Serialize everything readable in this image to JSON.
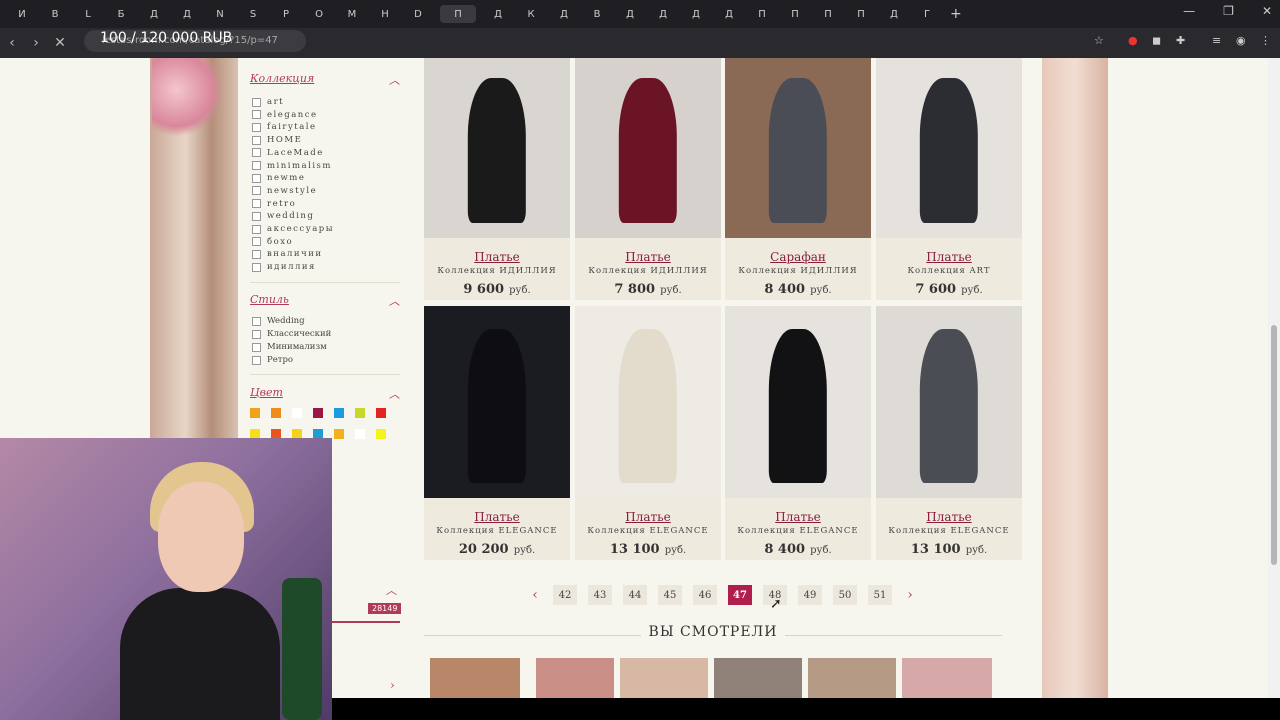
{
  "browser": {
    "tab_letters": [
      "И",
      "В",
      "L",
      "Б",
      "Д",
      "Д",
      "N",
      "S",
      "Р",
      "О",
      "М",
      "Н",
      "D",
      "П",
      "Д",
      "К",
      "Д",
      "В",
      "Д",
      "Д",
      "Д",
      "Д",
      "П",
      "П",
      "П",
      "П",
      "Д",
      "Г"
    ],
    "active_tab_label": "П",
    "url": "lestas-room.com/catalog/?15/p=47",
    "overlay_text": "100 / 120 000 RUB"
  },
  "sidebar": {
    "collection": {
      "title": "Коллекция",
      "options": [
        "art",
        "elegance",
        "fairytale",
        "HOME",
        "LaceMade",
        "minimalism",
        "newme",
        "newstyle",
        "retro",
        "wedding",
        "аксессуары",
        "бохо",
        "вналичии",
        "идиллия"
      ]
    },
    "style": {
      "title": "Стиль",
      "options": [
        "Wedding",
        "Классический",
        "Минимализм",
        "Ретро"
      ]
    },
    "color": {
      "title": "Цвет",
      "swatches": [
        "#f0a21c",
        "#f08c1c",
        "#ffffff",
        "#9c1646",
        "#1b9be0",
        "#c8d82a",
        "#e2231f",
        "#f6e01b",
        "#e8561c",
        "#f4d31a",
        "#1f9bd6",
        "#f1b21e",
        "#ffffff",
        "#f6f21c"
      ]
    },
    "count": "28149"
  },
  "products": [
    {
      "name": "Платье",
      "collection": "Коллекция ИДИЛЛИЯ",
      "price": "9 600",
      "currency": "руб."
    },
    {
      "name": "Платье",
      "collection": "Коллекция ИДИЛЛИЯ",
      "price": "7 800",
      "currency": "руб."
    },
    {
      "name": "Сарафан",
      "collection": "Коллекция ИДИЛЛИЯ",
      "price": "8 400",
      "currency": "руб."
    },
    {
      "name": "Платье",
      "collection": "Коллекция ART",
      "price": "7 600",
      "currency": "руб."
    },
    {
      "name": "Платье",
      "collection": "Коллекция ELEGANCE",
      "price": "20 200",
      "currency": "руб."
    },
    {
      "name": "Платье",
      "collection": "Коллекция ELEGANCE",
      "price": "13 100",
      "currency": "руб."
    },
    {
      "name": "Платье",
      "collection": "Коллекция ELEGANCE",
      "price": "8 400",
      "currency": "руб."
    },
    {
      "name": "Платье",
      "collection": "Коллекция ELEGANCE",
      "price": "13 100",
      "currency": "руб."
    }
  ],
  "pagination": {
    "pages": [
      "42",
      "43",
      "44",
      "45",
      "46",
      "47",
      "48",
      "49",
      "50",
      "51"
    ],
    "current": "47"
  },
  "recently_viewed": {
    "title": "ВЫ СМОТРЕЛИ"
  }
}
